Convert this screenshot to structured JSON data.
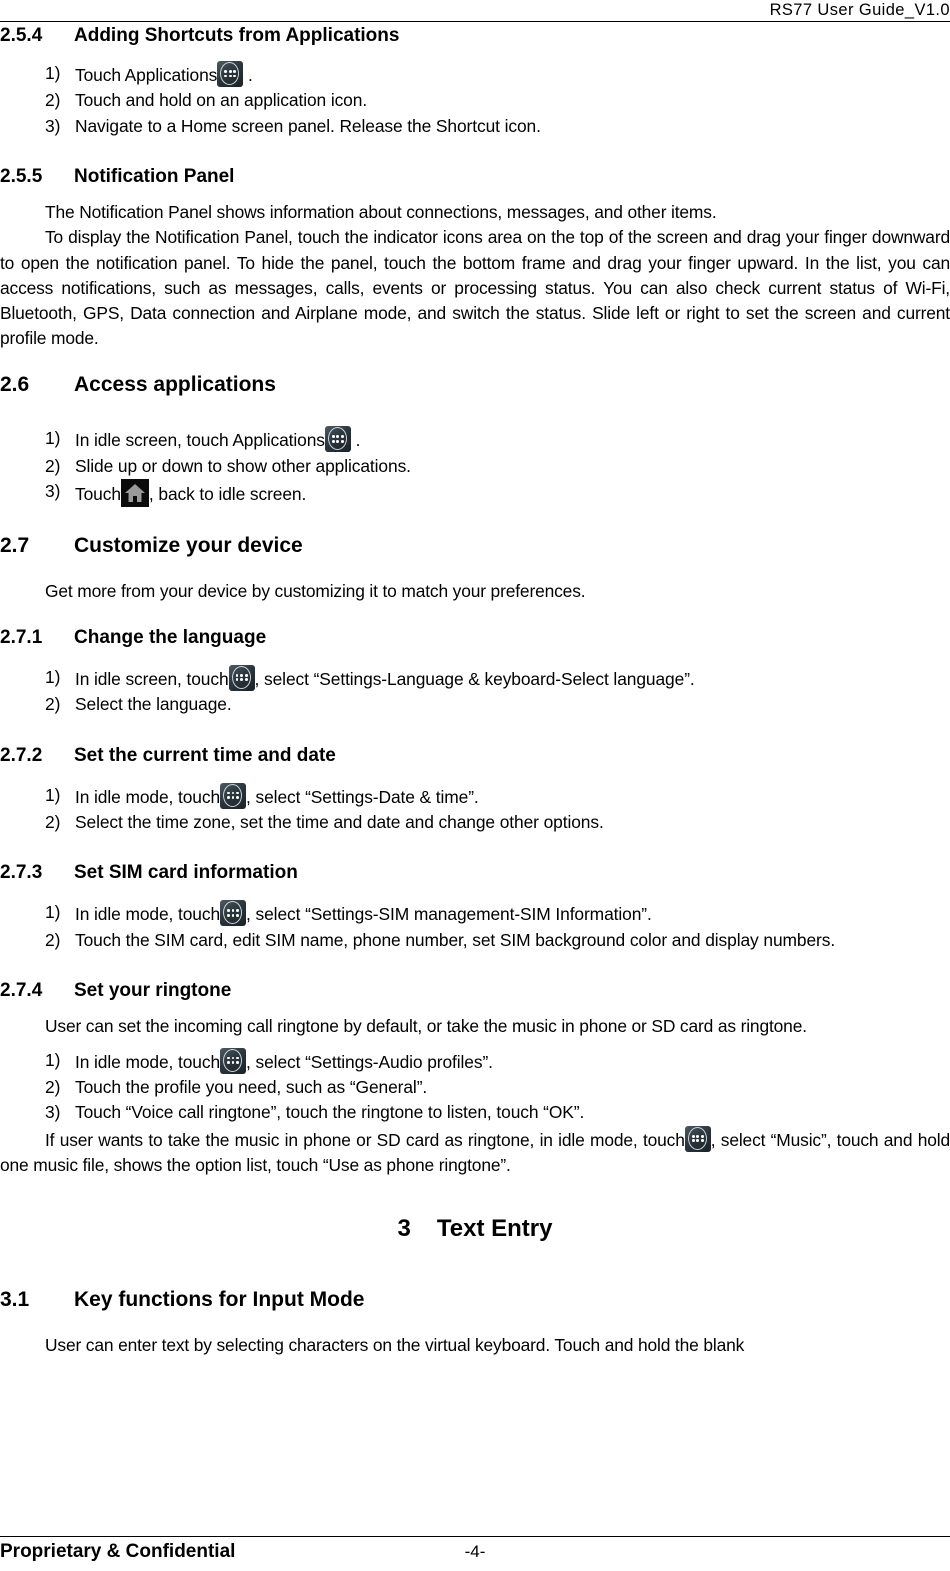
{
  "header": {
    "title": "RS77  User  Guide_V1.0"
  },
  "sections": {
    "s254": {
      "number": "2.5.4",
      "title": "Adding Shortcuts from Applications",
      "steps": [
        {
          "marker": "1)",
          "text_before": "Touch Applications",
          "icon": "apps-icon",
          "text_after": " ."
        },
        {
          "marker": "2)",
          "text_before": "Touch and hold on an application icon.",
          "icon": null,
          "text_after": ""
        },
        {
          "marker": "3)",
          "text_before": "Navigate to a Home screen panel. Release the Shortcut icon.",
          "icon": null,
          "text_after": ""
        }
      ]
    },
    "s255": {
      "number": "2.5.5",
      "title": "Notification Panel",
      "para1": "The Notification Panel shows information about connections, messages, and other items.",
      "para2": "To display the Notification Panel, touch the indicator icons area on the top of the screen and drag your finger downward to open the notification panel. To hide the panel, touch the bottom frame and drag your finger upward. In the list, you can access notifications, such as messages, calls, events or processing status. You can also check current status of Wi-Fi, Bluetooth, GPS, Data connection and Airplane mode, and switch the status. Slide left or right to set the screen and current profile mode."
    },
    "s26": {
      "number": "2.6",
      "title": "Access applications",
      "steps": [
        {
          "marker": "1)",
          "text_before": "In idle screen, touch Applications",
          "icon": "apps-icon",
          "text_after": " ."
        },
        {
          "marker": "2)",
          "text_before": "Slide up or down to show other applications.",
          "icon": null,
          "text_after": ""
        },
        {
          "marker": "3)",
          "text_before": "Touch",
          "icon": "home-icon",
          "text_after": ", back to idle screen."
        }
      ]
    },
    "s27": {
      "number": "2.7",
      "title": "Customize your device",
      "para1": "Get more from your device by customizing it to match your preferences."
    },
    "s271": {
      "number": "2.7.1",
      "title": "Change the language",
      "steps": [
        {
          "marker": "1)",
          "text_before": "In idle screen, touch",
          "icon": "apps-icon",
          "text_after": ", select “Settings-Language & keyboard-Select language”."
        },
        {
          "marker": "2)",
          "text_before": "Select the language.",
          "icon": null,
          "text_after": ""
        }
      ]
    },
    "s272": {
      "number": "2.7.2",
      "title": "Set the current time and date",
      "steps": [
        {
          "marker": "1)",
          "text_before": "In idle mode, touch",
          "icon": "apps-icon",
          "text_after": ", select “Settings-Date & time”."
        },
        {
          "marker": "2)",
          "text_before": "Select the time zone, set the time and date and change other options.",
          "icon": null,
          "text_after": ""
        }
      ]
    },
    "s273": {
      "number": "2.7.3",
      "title": "Set SIM card information",
      "steps": [
        {
          "marker": "1)",
          "text_before": "In idle mode, touch",
          "icon": "apps-icon",
          "text_after": ", select “Settings-SIM management-SIM Information”."
        },
        {
          "marker": "2)",
          "text_before": "Touch the SIM card, edit SIM name, phone number, set SIM background color and display numbers.",
          "icon": null,
          "text_after": ""
        }
      ]
    },
    "s274": {
      "number": "2.7.4",
      "title": "Set your ringtone",
      "para1": "User can set the incoming call ringtone by default, or take the music in phone or SD card as ringtone.",
      "steps": [
        {
          "marker": "1)",
          "text_before": "In idle mode, touch",
          "icon": "apps-icon",
          "text_after": ", select “Settings-Audio profiles”."
        },
        {
          "marker": "2)",
          "text_before": "Touch the profile you need, such as “General”.",
          "icon": null,
          "text_after": ""
        },
        {
          "marker": "3)",
          "text_before": "Touch “Voice call ringtone”, touch the ringtone to listen, touch “OK”.",
          "icon": null,
          "text_after": ""
        }
      ],
      "para2_before": "If user wants to take the music in phone or SD card as ringtone, in idle mode, touch",
      "para2_icon": "apps-icon",
      "para2_after": ", select “Music”, touch and hold one music file, shows the option list, touch “Use as phone ringtone”."
    },
    "chapter3": {
      "number": "3",
      "title": "Text Entry"
    },
    "s31": {
      "number": "3.1",
      "title": "Key functions for Input Mode",
      "para1": "User can enter text by selecting characters on the virtual keyboard. Touch and hold the blank"
    }
  },
  "footer": {
    "left": "Proprietary & Confidential",
    "page": "-4-"
  }
}
